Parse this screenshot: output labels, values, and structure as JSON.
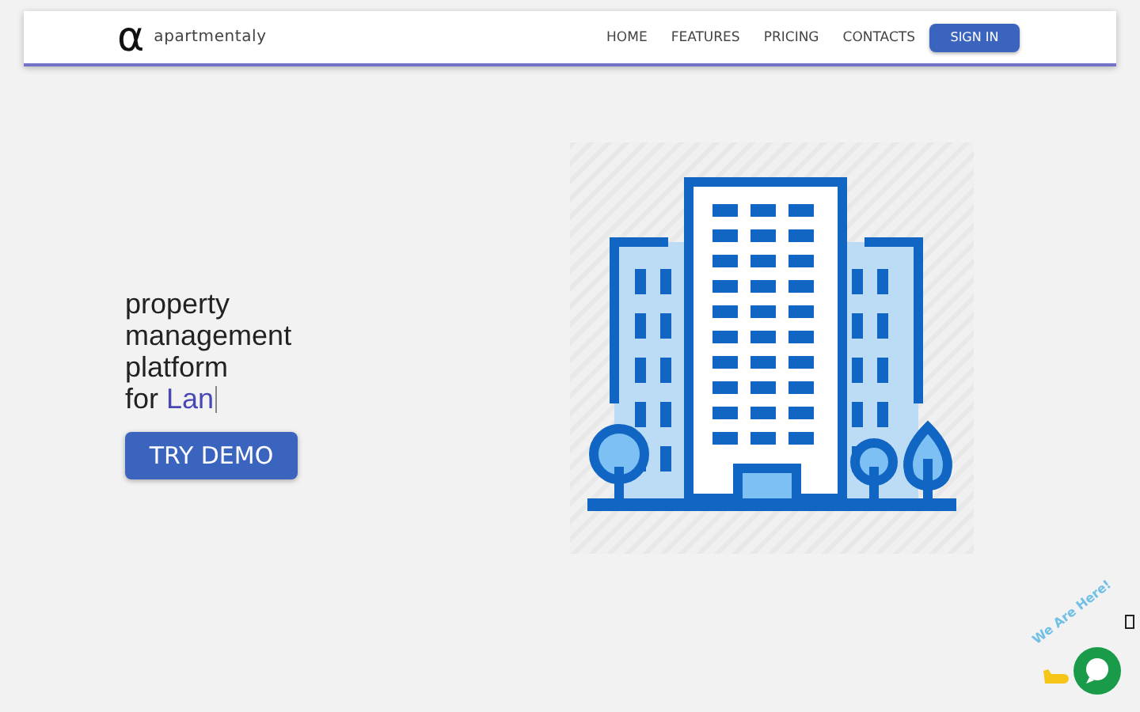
{
  "navbar": {
    "logo_mark": "α",
    "brand": "apartmentaly",
    "links": [
      {
        "label": "HOME"
      },
      {
        "label": "FEATURES"
      },
      {
        "label": "PRICING"
      },
      {
        "label": "CONTACTS"
      }
    ],
    "sign_in": "SIGN IN"
  },
  "hero": {
    "headline": "property management platform",
    "typed_prefix": "for",
    "typed_text": "Lan",
    "cta": "TRY DEMO"
  },
  "chat_widget": {
    "greeting": "We Are Here!"
  }
}
